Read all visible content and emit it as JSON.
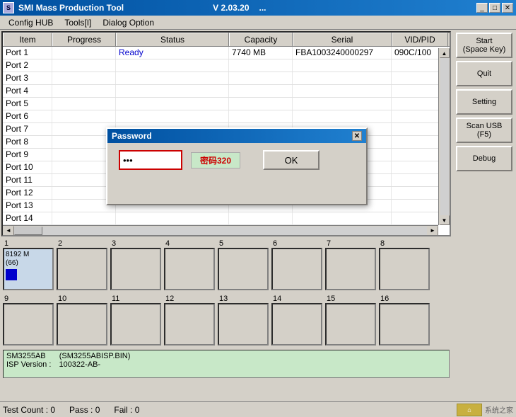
{
  "window": {
    "title": "SMI Mass Production Tool",
    "version": "V 2.03.20",
    "dots": "..."
  },
  "menu": {
    "items": [
      "Config HUB",
      "Tools[I]",
      "Dialog Option"
    ]
  },
  "table": {
    "columns": [
      "Item",
      "Progress",
      "Status",
      "Capacity",
      "Serial",
      "VID/PID"
    ],
    "rows": [
      {
        "item": "Port 1",
        "progress": "",
        "status": "Ready",
        "capacity": "7740 MB",
        "serial": "FBA1003240000297",
        "vidpid": "090C/100"
      },
      {
        "item": "Port 2",
        "progress": "",
        "status": "",
        "capacity": "",
        "serial": "",
        "vidpid": ""
      },
      {
        "item": "Port 3",
        "progress": "",
        "status": "",
        "capacity": "",
        "serial": "",
        "vidpid": ""
      },
      {
        "item": "Port 4",
        "progress": "",
        "status": "",
        "capacity": "",
        "serial": "",
        "vidpid": ""
      },
      {
        "item": "Port 5",
        "progress": "",
        "status": "",
        "capacity": "",
        "serial": "",
        "vidpid": ""
      },
      {
        "item": "Port 6",
        "progress": "",
        "status": "",
        "capacity": "",
        "serial": "",
        "vidpid": ""
      },
      {
        "item": "Port 7",
        "progress": "",
        "status": "",
        "capacity": "",
        "serial": "",
        "vidpid": ""
      },
      {
        "item": "Port 8",
        "progress": "",
        "status": "",
        "capacity": "",
        "serial": "",
        "vidpid": ""
      },
      {
        "item": "Port 9",
        "progress": "",
        "status": "",
        "capacity": "",
        "serial": "",
        "vidpid": ""
      },
      {
        "item": "Port 10",
        "progress": "",
        "status": "",
        "capacity": "",
        "serial": "",
        "vidpid": ""
      },
      {
        "item": "Port 11",
        "progress": "",
        "status": "",
        "capacity": "",
        "serial": "",
        "vidpid": ""
      },
      {
        "item": "Port 12",
        "progress": "",
        "status": "",
        "capacity": "",
        "serial": "",
        "vidpid": ""
      },
      {
        "item": "Port 13",
        "progress": "",
        "status": "",
        "capacity": "",
        "serial": "",
        "vidpid": ""
      },
      {
        "item": "Port 14",
        "progress": "",
        "status": "",
        "capacity": "",
        "serial": "",
        "vidpid": ""
      }
    ]
  },
  "buttons": {
    "start": "Start\n(Space Key)",
    "quit": "Quit",
    "setting": "Setting",
    "scan_usb": "Scan USB\n(F5)",
    "debug": "Debug"
  },
  "drive_rows": {
    "row1_labels": [
      "1",
      "2",
      "3",
      "4",
      "5",
      "6",
      "7",
      "8"
    ],
    "row2_labels": [
      "9",
      "10",
      "11",
      "12",
      "13",
      "14",
      "15",
      "16"
    ]
  },
  "slot1": {
    "capacity": "8192 M",
    "number": "(66)"
  },
  "firmware": {
    "chip": "SM3255AB",
    "file": "(SM3255ABISP.BIN)",
    "label_isp": "ISP Version :",
    "version": "100322-AB-"
  },
  "status_bar": {
    "test_count": "Test Count : 0",
    "pass": "Pass : 0",
    "fail": "Fail : 0"
  },
  "dialog": {
    "title": "Password",
    "hint": "密码320",
    "password_value": "***",
    "password_placeholder": "",
    "ok_label": "OK",
    "close_icon": "✕"
  },
  "colors": {
    "accent_blue": "#0050a0",
    "ready_color": "#0000cc",
    "dialog_hint_color": "#cc0000"
  }
}
